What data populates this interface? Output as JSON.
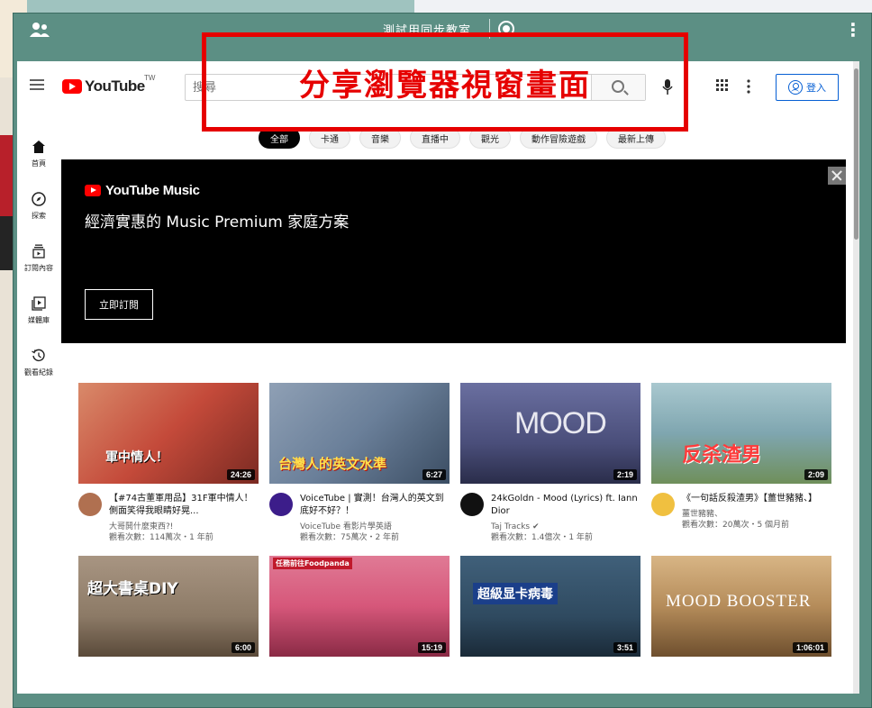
{
  "share_window": {
    "title": "測試用同步教室",
    "more_label": "⋮"
  },
  "youtube": {
    "logo_text": "YouTube",
    "region": "TW",
    "search_placeholder": "搜尋",
    "signin_label": "登入",
    "chips": [
      "全部",
      "卡通",
      "音樂",
      "直播中",
      "觀光",
      "動作冒險遊戲",
      "最新上傳"
    ],
    "sidebar": [
      {
        "label": "首頁",
        "icon": "home-icon"
      },
      {
        "label": "探索",
        "icon": "compass-icon"
      },
      {
        "label": "訂閱內容",
        "icon": "subscriptions-icon"
      },
      {
        "label": "媒體庫",
        "icon": "library-icon"
      },
      {
        "label": "觀看紀錄",
        "icon": "history-icon"
      }
    ],
    "banner": {
      "logo_text": "YouTube Music",
      "headline": "經濟實惠的 Music Premium 家庭方案",
      "button": "立即訂閱"
    },
    "videos_row1": [
      {
        "title": "【#74古董軍用品】31F軍中情人！側面笑得我眼睛好晃...",
        "channel": "大哥鬨什麼東西?!",
        "stats": "觀看次數：114萬次・1 年前",
        "duration": "24:26",
        "thumb_text": "軍中情人！",
        "thumb_color": "#c44a3a",
        "avatar_color": "#b07050"
      },
      {
        "title": "VoiceTube | 實測！台灣人的英文到底好不好？！",
        "channel": "VoiceTube 看影片學英語",
        "stats": "觀看次數：75萬次・2 年前",
        "duration": "6:27",
        "thumb_text": "台灣人的英文水準",
        "thumb_color": "#6a7f99",
        "avatar_color": "#3c1d8a"
      },
      {
        "title": "24kGoldn - Mood (Lyrics) ft. Iann Dior",
        "channel": "Taj Tracks ✔",
        "stats": "觀看次數：1.4億次・1 年前",
        "duration": "2:19",
        "thumb_text": "MOOD",
        "thumb_color": "#4a4e7a",
        "avatar_color": "#111111"
      },
      {
        "title": "《一句話反殺渣男》【薑世豬豬、】",
        "channel": "薑世豬豬、",
        "stats": "觀看次數：20萬次・5 個月前",
        "duration": "2:09",
        "thumb_text": "反杀渣男",
        "thumb_color": "#7fa6b0",
        "avatar_color": "#f0c040"
      }
    ],
    "videos_row2": [
      {
        "duration": "6:00",
        "thumb_text": "超大書桌DIY",
        "thumb_color": "#8c7a66"
      },
      {
        "duration": "15:19",
        "thumb_text": "任務前往Foodpanda",
        "thumb_color": "#d6577a"
      },
      {
        "duration": "3:51",
        "thumb_text": "超級显卡病毒",
        "thumb_color": "#2f4a60"
      },
      {
        "duration": "1:06:01",
        "thumb_text": "MOOD BOOSTER",
        "thumb_color": "#b58c5a"
      }
    ]
  },
  "annotation": {
    "text": "分享瀏覽器視窗畫面",
    "color": "#e60000"
  }
}
